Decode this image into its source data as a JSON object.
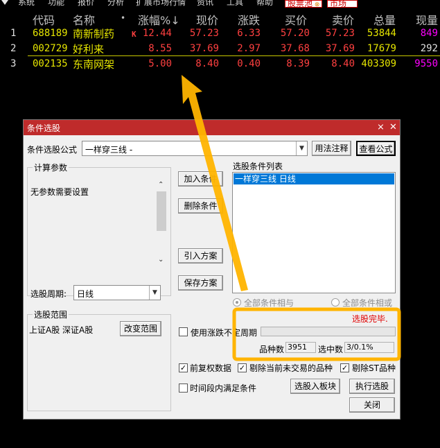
{
  "menubar": {
    "items": [
      "系统",
      "功能",
      "报价",
      "分析",
      "扩展市场行情",
      "资讯",
      "工具",
      "帮助"
    ],
    "tabs": [
      "股票池",
      "市场"
    ]
  },
  "quote_table": {
    "headers": [
      "代码",
      "名称",
      "•",
      "涨幅%↓",
      "现价",
      "涨跌",
      "买价",
      "卖价",
      "总量",
      "现量"
    ],
    "rows": [
      {
        "idx": "1",
        "code": "688189",
        "name": "南新制药",
        "flag": "K",
        "change_pct": "12.44",
        "price": "57.23",
        "change": "6.33",
        "bid": "57.20",
        "ask": "57.23",
        "volume": "53844",
        "cur_vol": "849"
      },
      {
        "idx": "2",
        "code": "002729",
        "name": "好利来",
        "flag": "",
        "change_pct": "8.55",
        "price": "37.69",
        "change": "2.97",
        "bid": "37.68",
        "ask": "37.69",
        "volume": "17679",
        "cur_vol": "292"
      },
      {
        "idx": "3",
        "code": "002135",
        "name": "东南网架",
        "flag": "",
        "change_pct": "5.00",
        "price": "8.40",
        "change": "0.40",
        "bid": "8.39",
        "ask": "8.40",
        "volume": "403309",
        "cur_vol": "9550"
      }
    ],
    "colors": {
      "red": "#ff4040",
      "yellow": "#e6e600",
      "magenta": "#ff00ff",
      "white": "#e0e0e0"
    }
  },
  "dialog": {
    "title": "条件选股",
    "formula_label": "条件选股公式",
    "formula_value": "一样穿三线    -",
    "usage_button": "用法注释",
    "view_formula_button": "查看公式",
    "calc_params_title": "计算参数",
    "no_params_text": "无参数需要设置",
    "period_label": "选股周期:",
    "period_value": "日线",
    "scope_title": "选股范围",
    "scope_text": "上证A股  深证A股",
    "change_scope_button": "改变范围",
    "add_condition_button": "加入条件",
    "delete_condition_button": "删除条件",
    "import_plan_button": "引入方案",
    "save_plan_button": "保存方案",
    "conditions_list_title": "选股条件列表",
    "conditions_list_items": [
      "一样穿三线  日线"
    ],
    "radio_all_and": "全部条件相与",
    "radio_all_or": "全部条件相或",
    "use_price_change_period": "使用涨跌不定周期",
    "status_text": "选股完毕.",
    "stock_count_label": "品种数",
    "stock_count_value": "3951",
    "selected_count_label": "选中数",
    "selected_count_value": "3/0.1%",
    "pre_adjusted": "前复权数据",
    "exclude_non_trading": "剔除当前未交易的品种",
    "exclude_st": "剔除ST品种",
    "time_range_condition": "时间段内满足条件",
    "select_to_block_button": "选股入板块",
    "execute_button": "执行选股",
    "close_button": "关闭"
  }
}
